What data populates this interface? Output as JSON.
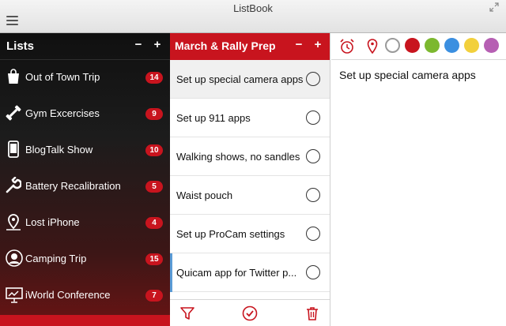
{
  "window": {
    "title": "ListBook"
  },
  "sidebar": {
    "title": "Lists",
    "minus": "−",
    "plus": "+",
    "items": [
      {
        "label": "Out of Town Trip",
        "count": "14",
        "icon": "shopping-bag-icon"
      },
      {
        "label": "Gym Excercises",
        "count": "9",
        "icon": "dumbbell-icon"
      },
      {
        "label": "BlogTalk Show",
        "count": "10",
        "icon": "phone-icon"
      },
      {
        "label": "Battery Recalibration",
        "count": "5",
        "icon": "wrench-icon"
      },
      {
        "label": "Lost iPhone",
        "count": "4",
        "icon": "map-pin-icon"
      },
      {
        "label": "Camping Trip",
        "count": "15",
        "icon": "person-icon"
      },
      {
        "label": "iWorld Conference",
        "count": "7",
        "icon": "presentation-icon"
      }
    ]
  },
  "list": {
    "title": "March & Rally Prep",
    "minus": "−",
    "plus": "+",
    "tasks": [
      {
        "label": "Set up special camera apps"
      },
      {
        "label": "Set up 911 apps"
      },
      {
        "label": "Walking shows, no sandles"
      },
      {
        "label": "Waist pouch"
      },
      {
        "label": "Set up ProCam settings"
      },
      {
        "label": "Quicam app for Twitter p..."
      }
    ]
  },
  "detail": {
    "text": "Set up special camera apps",
    "colors": [
      "#ffffff",
      "#c8141e",
      "#7cb82f",
      "#3b8fe0",
      "#f2d03c",
      "#b65fb3"
    ]
  },
  "colors": {
    "accent": "#c8141e",
    "selection": "#5a9bd6"
  }
}
